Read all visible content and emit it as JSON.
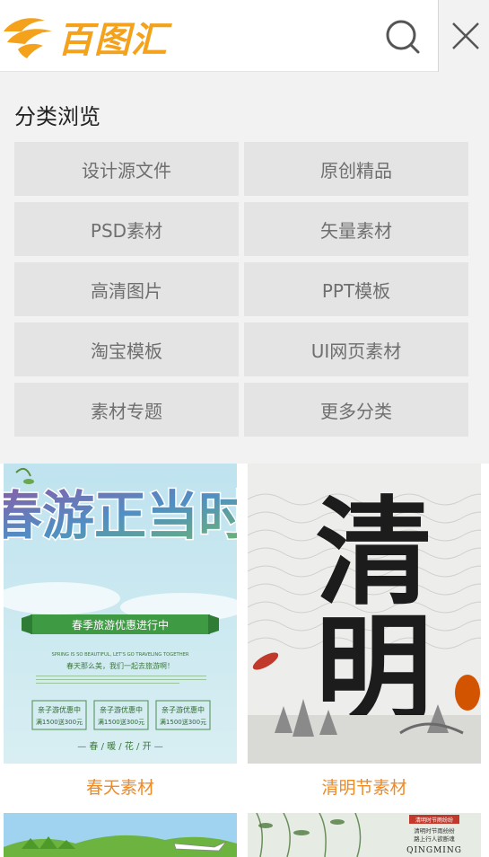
{
  "header": {
    "logo_text": "百图汇",
    "search_icon": "search-icon",
    "close_icon": "close-icon"
  },
  "panel": {
    "title": "分类浏览",
    "categories": [
      {
        "label": "设计源文件"
      },
      {
        "label": "原创精品"
      },
      {
        "label": "PSD素材"
      },
      {
        "label": "矢量素材"
      },
      {
        "label": "高清图片"
      },
      {
        "label": "PPT模板"
      },
      {
        "label": "淘宝模板"
      },
      {
        "label": "UI网页素材"
      },
      {
        "label": "素材专题"
      },
      {
        "label": "更多分类"
      }
    ]
  },
  "content": {
    "cards": [
      {
        "label": "春天素材",
        "poster_title": "春游正当时",
        "banner": "春季旅游优惠进行中",
        "tagline_en": "SPRING IS SO BEAUTIFUL, LET'S GO TRAVELING TOGETHER",
        "tagline_cn": "春天那么美，我们一起去旅游啊！",
        "coupons": [
          "亲子游优惠中",
          "亲子游优惠中",
          "亲子游优惠中"
        ],
        "coupon_sub": [
          "满1500送300元",
          "满1500送300元",
          "满1500送300元"
        ],
        "footer": "— 春 / 暖 / 花 / 开 —"
      },
      {
        "label": "清明节素材",
        "poster_title": "清明"
      }
    ],
    "next_row": {
      "right_tag": "清明时节雨纷纷",
      "right_line1": "清明时节雨纷纷",
      "right_line2": "路上行人欲断魂",
      "right_en": "QINGMING"
    }
  },
  "colors": {
    "accent": "#f08a24",
    "logo": "#f4a21b",
    "panel_bg": "#f2f2f2",
    "tile_bg": "#e4e4e4"
  }
}
